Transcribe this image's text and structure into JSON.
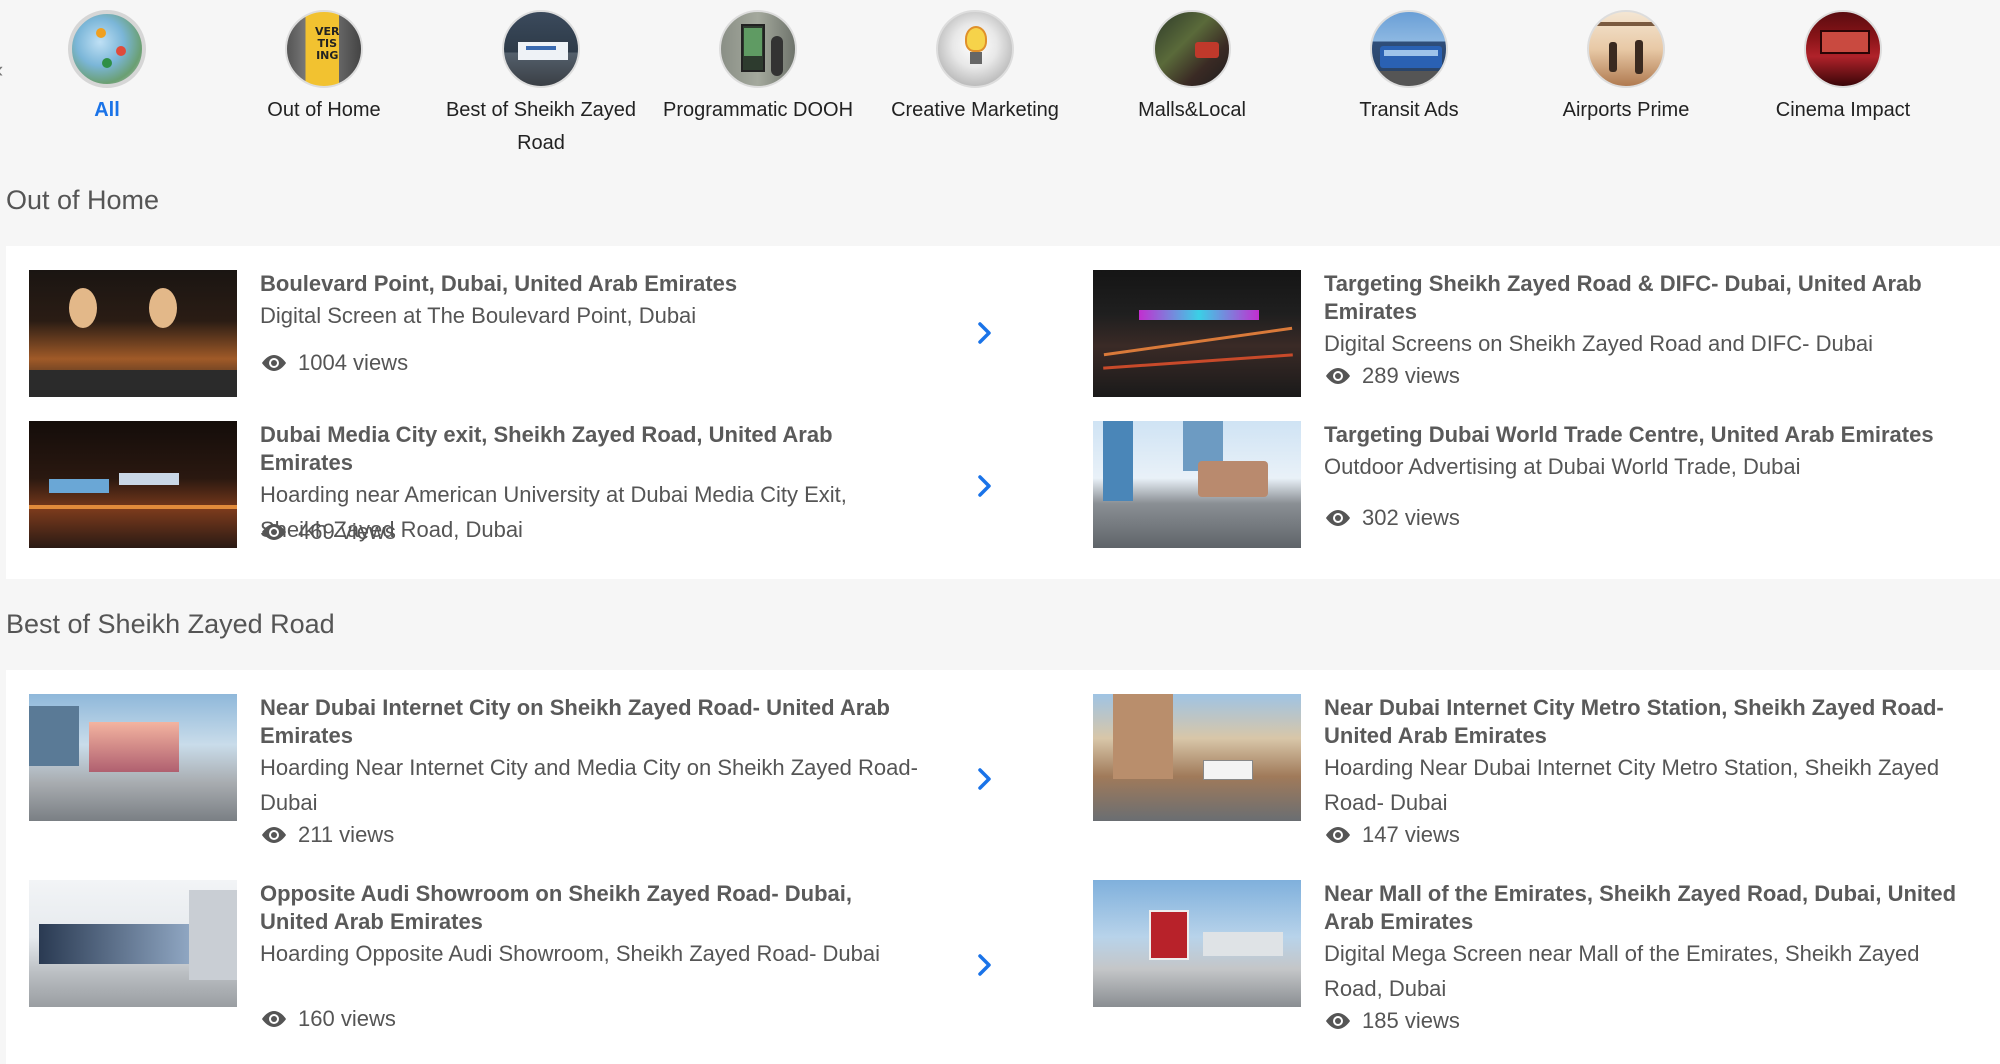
{
  "categories": [
    {
      "label": "All",
      "icon": "globe-map-icon",
      "active": true
    },
    {
      "label": "Out of Home",
      "icon": "poster-icon"
    },
    {
      "label": "Best of Sheikh Zayed Road",
      "icon": "billboard-icon"
    },
    {
      "label": "Programmatic DOOH",
      "icon": "digital-kiosk-icon"
    },
    {
      "label": "Creative Marketing",
      "icon": "lightbulb-icon"
    },
    {
      "label": "Malls&Local",
      "icon": "shopping-cart-icon"
    },
    {
      "label": "Transit Ads",
      "icon": "bus-icon"
    },
    {
      "label": "Airports Prime",
      "icon": "airport-icon"
    },
    {
      "label": "Cinema Impact",
      "icon": "cinema-icon"
    }
  ],
  "sections": [
    {
      "title": "Out of Home",
      "items": [
        {
          "title": "Boulevard Point, Dubai, United Arab Emirates",
          "desc": "Digital Screen at The Boulevard Point, Dubai",
          "views": "1004 views"
        },
        {
          "title": "Targeting Sheikh Zayed Road & DIFC- Dubai, United Arab Emirates",
          "desc": "Digital Screens on Sheikh Zayed Road and DIFC- Dubai",
          "views": "289 views"
        },
        {
          "title": "Dubai Media City exit, Sheikh Zayed Road, United Arab Emirates",
          "desc": "Hoarding near American University at Dubai Media City Exit, Sheikh Zayed Road, Dubai",
          "views": "469 views"
        },
        {
          "title": "Targeting Dubai World Trade Centre, United Arab Emirates",
          "desc": "Outdoor Advertising at Dubai World Trade, Dubai",
          "views": "302 views"
        }
      ]
    },
    {
      "title": "Best of Sheikh Zayed Road",
      "items": [
        {
          "title": "Near Dubai Internet City on Sheikh Zayed Road- United Arab Emirates",
          "desc": "Hoarding Near Internet City and Media City on Sheikh Zayed Road- Dubai",
          "views": "211 views"
        },
        {
          "title": "Near Dubai Internet City Metro Station, Sheikh Zayed Road- United Arab Emirates",
          "desc": "Hoarding Near Dubai Internet City Metro Station, Sheikh Zayed Road- Dubai",
          "views": "147 views"
        },
        {
          "title": "Opposite Audi Showroom on Sheikh Zayed Road- Dubai, United Arab Emirates",
          "desc": "Hoarding Opposite Audi Showroom, Sheikh Zayed Road- Dubai",
          "views": "160 views"
        },
        {
          "title": "Near Mall of the Emirates, Sheikh Zayed Road, Dubai, United Arab Emirates",
          "desc": "Digital Mega Screen near Mall of the Emirates, Sheikh Zayed Road, Dubai",
          "views": "185 views"
        }
      ]
    }
  ],
  "colors": {
    "accent": "#1a73e8",
    "text": "#555555",
    "panel": "#ffffff",
    "background": "#f6f6f6"
  }
}
